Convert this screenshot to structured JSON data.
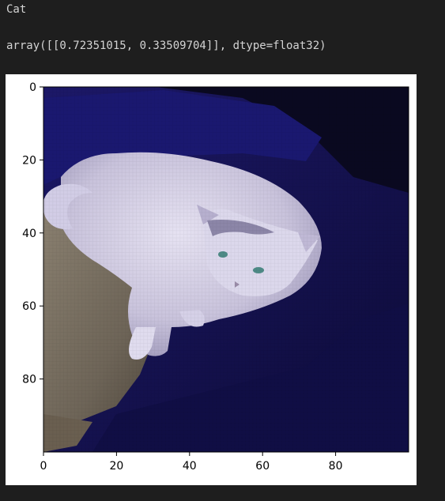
{
  "cell_output": {
    "print_line": "Cat",
    "result_line": "array([[0.72351015, 0.33509704]], dtype=float32)"
  },
  "image_plot": {
    "x_ticks": [
      0,
      20,
      40,
      60,
      80
    ],
    "y_ticks": [
      0,
      20,
      40,
      60,
      80
    ],
    "x_range": [
      0,
      100
    ],
    "y_range": [
      0,
      100
    ],
    "y_axis_inverted": true,
    "subject": "white-cat-on-dark-blue-blanket"
  },
  "colors": {
    "background": "#1e1e1e",
    "text": "#d4d4d4",
    "blanket": "#16135a",
    "cat": "#d8d4ea"
  }
}
